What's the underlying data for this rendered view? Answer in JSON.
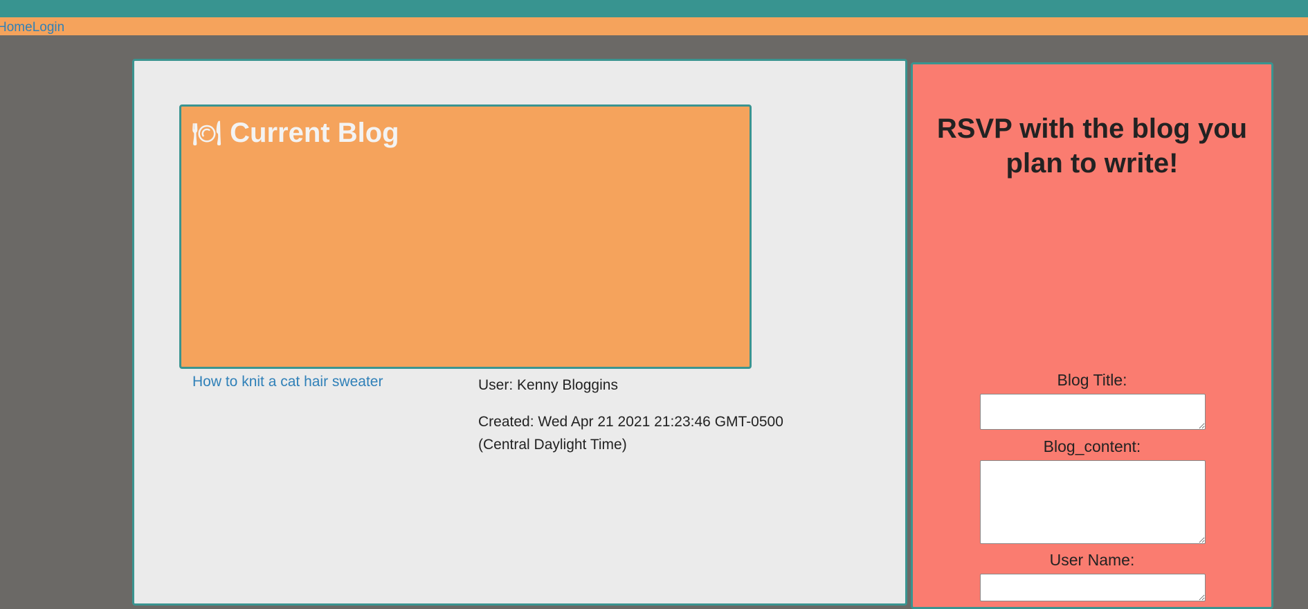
{
  "nav": {
    "home_label": "Home",
    "login_label": "Login"
  },
  "blog": {
    "card_title": "Current Blog",
    "card_icon": "plate-cutlery-icon",
    "post_title": "How to knit a cat hair sweater",
    "user_line": "User: Kenny Bloggins",
    "created_line": "Created: Wed Apr 21 2021 21:23:46 GMT-0500 (Central Daylight Time)"
  },
  "rsvp": {
    "heading": "RSVP with the blog you plan to write!",
    "blog_title_label": "Blog Title:",
    "blog_title_value": "",
    "blog_content_label": "Blog_content:",
    "blog_content_value": "",
    "user_name_label": "User Name:",
    "user_name_value": ""
  },
  "colors": {
    "topbar": "#389490",
    "navbar": "#f5a35c",
    "page_bg": "#6b6966",
    "main_panel_bg": "#ebebeb",
    "card_bg": "#f5a35c",
    "rsvp_bg": "#fa7c70",
    "link": "#2f80b8",
    "border_accent": "#3a9490"
  }
}
